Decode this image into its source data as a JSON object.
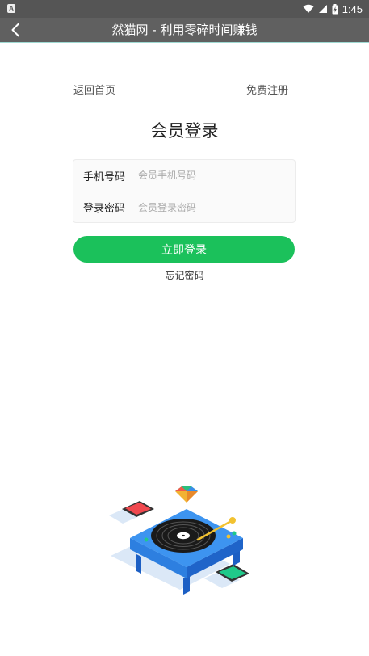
{
  "status_bar": {
    "time": "1:45",
    "left_icon": "A",
    "icons": [
      "wifi-icon",
      "signal-icon",
      "battery-icon"
    ]
  },
  "app_bar": {
    "title": "然猫网 - 利用零碎时间赚钱",
    "back_icon": "chevron-left-icon"
  },
  "top_links": {
    "home": "返回首页",
    "register": "免费注册"
  },
  "page_title": "会员登录",
  "form": {
    "phone": {
      "label": "手机号码",
      "placeholder": "会员手机号码",
      "value": ""
    },
    "password": {
      "label": "登录密码",
      "placeholder": "会员登录密码",
      "value": ""
    }
  },
  "login_button": "立即登录",
  "forgot_password": "忘记密码",
  "colors": {
    "status_bar": "#555555",
    "app_bar": "#606060",
    "accent_green": "#1bc15b"
  },
  "illustration": "turntable-illustration"
}
